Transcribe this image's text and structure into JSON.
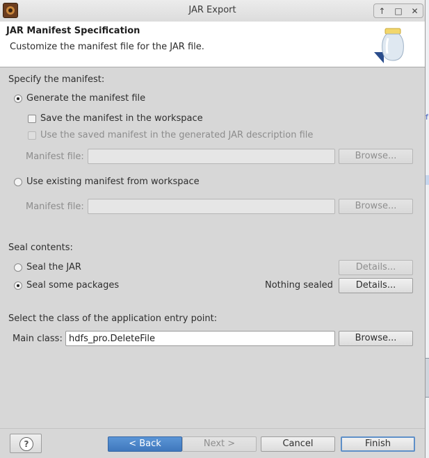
{
  "window": {
    "title": "JAR Export",
    "controls": [
      "↑",
      "□",
      "✕"
    ]
  },
  "banner": {
    "title": "JAR Manifest Specification",
    "description": "Customize the manifest file for the JAR file."
  },
  "manifest": {
    "section_label": "Specify the manifest:",
    "generate_option": {
      "label": "Generate the manifest file",
      "selected": true
    },
    "save_in_workspace": {
      "label": "Save the manifest in the workspace",
      "checked": false
    },
    "use_saved_in_description": {
      "label": "Use the saved manifest in the generated JAR description file",
      "checked": false,
      "enabled": false
    },
    "manifest_file_label_1": "Manifest file:",
    "manifest_file_value_1": "",
    "browse_1": "Browse...",
    "existing_option": {
      "label": "Use existing manifest from workspace",
      "selected": false
    },
    "manifest_file_label_2": "Manifest file:",
    "manifest_file_value_2": "",
    "browse_2": "Browse..."
  },
  "seal": {
    "section_label": "Seal contents:",
    "seal_jar": {
      "label": "Seal the JAR",
      "selected": false
    },
    "seal_jar_details": "Details...",
    "seal_packages": {
      "label": "Seal some packages",
      "selected": true
    },
    "status": "Nothing sealed",
    "seal_packages_details": "Details..."
  },
  "entry_point": {
    "section_label": "Select the class of the application entry point:",
    "main_class_label": "Main class:",
    "main_class_value": "hdfs_pro.DeleteFile",
    "browse": "Browse..."
  },
  "footer": {
    "help": "?",
    "back": "< Back",
    "next": "Next >",
    "cancel": "Cancel",
    "finish": "Finish"
  },
  "colors": {
    "dialog_bg": "#d7d7d7",
    "banner_bg": "#ffffff",
    "accent": "#4a86c8"
  },
  "background_fragment": {
    "text": "f"
  }
}
